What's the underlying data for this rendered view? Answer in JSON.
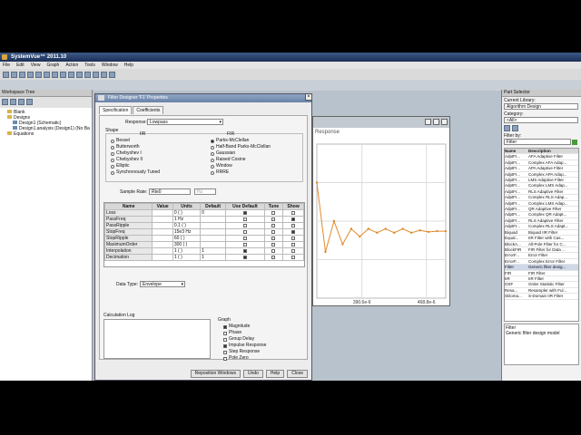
{
  "app": {
    "title": "SystemVue™ 2011.10"
  },
  "menu": [
    "File",
    "Edit",
    "View",
    "Graph",
    "Action",
    "Tools",
    "Window",
    "Help"
  ],
  "workspace": {
    "title": "Workspace Tree",
    "items": [
      {
        "label": "Blank",
        "indent": 1
      },
      {
        "label": "Designs",
        "indent": 1
      },
      {
        "label": "Design1 (Schematic)",
        "indent": 2
      },
      {
        "label": "Design1.analysis (Design1) (No Ba",
        "indent": 2
      },
      {
        "label": "Equations",
        "indent": 1
      }
    ]
  },
  "dialog": {
    "title": "Filter Designer 'F1' Properties",
    "tabs": [
      "Specification",
      "Coefficients"
    ],
    "response_label": "Response:",
    "response_value": "Lowpass",
    "shape_label": "Shape",
    "iir_label": "IIR",
    "fir_label": "FIR",
    "iir_options": [
      {
        "label": "Bessel",
        "on": false
      },
      {
        "label": "Butterworth",
        "on": false
      },
      {
        "label": "Chebyshev I",
        "on": false
      },
      {
        "label": "Chebyshev II",
        "on": false
      },
      {
        "label": "Elliptic",
        "on": false
      },
      {
        "label": "Synchronously Tuned",
        "on": false
      }
    ],
    "fir_options": [
      {
        "label": "Parks-McClellan",
        "on": true
      },
      {
        "label": "Half-Band Parks-McClellan",
        "on": false
      },
      {
        "label": "Gaussian",
        "on": false
      },
      {
        "label": "Raised Cosine",
        "on": false
      },
      {
        "label": "Window",
        "on": false
      },
      {
        "label": "RRRE",
        "on": false
      }
    ],
    "sample_rate_label": "Sample Rate:",
    "sample_rate_value": "Rte0",
    "sample_rate_unit": "Hz",
    "table": {
      "headers": [
        "Name",
        "Value",
        "Units",
        "Default",
        "Use Default",
        "Tune",
        "Show"
      ],
      "rows": [
        {
          "name": "Loss",
          "value": "",
          "units": "0 ( )",
          "default": "0",
          "use": true,
          "tune": false,
          "show": false
        },
        {
          "name": "PassFreq",
          "value": "",
          "units": "1 Hz",
          "default": "",
          "use": false,
          "tune": false,
          "show": true
        },
        {
          "name": "PassRipple",
          "value": "",
          "units": "0.1 ( )",
          "default": "",
          "use": false,
          "tune": false,
          "show": false
        },
        {
          "name": "StopFreq",
          "value": "",
          "units": "15e3 Hz",
          "default": "",
          "use": false,
          "tune": false,
          "show": true
        },
        {
          "name": "StopRipple",
          "value": "",
          "units": "60 ( )",
          "default": "",
          "use": false,
          "tune": false,
          "show": false
        },
        {
          "name": "MaximumOrder",
          "value": "",
          "units": "300 ( )",
          "default": "",
          "use": false,
          "tune": false,
          "show": false
        },
        {
          "name": "Interpolation",
          "value": "",
          "units": "1 ( )",
          "default": "1",
          "use": true,
          "tune": false,
          "show": false
        },
        {
          "name": "Decimation",
          "value": "",
          "units": "1 ( )",
          "default": "1",
          "use": true,
          "tune": false,
          "show": false
        }
      ]
    },
    "data_type_label": "Data Type:",
    "data_type_value": "Envelope",
    "calc_log_label": "Calculation Log",
    "graph_label": "Graph",
    "graph_options": [
      {
        "label": "Magnitude",
        "on": true
      },
      {
        "label": "Phase",
        "on": false
      },
      {
        "label": "Group Delay",
        "on": false
      },
      {
        "label": "Impulse Response",
        "on": true
      },
      {
        "label": "Step Response",
        "on": false
      },
      {
        "label": "Pole Zero",
        "on": false
      }
    ],
    "buttons": [
      "Reposition Windows",
      "Undo",
      "Help",
      "Close"
    ]
  },
  "graph_window": {
    "title": "Response",
    "x_ticks": [
      "390.6e-6",
      "468.8e-6"
    ]
  },
  "chart_data": {
    "type": "line",
    "title": "Response",
    "xlabel": "",
    "ylabel": "",
    "ylim": [
      0.9,
      1.1
    ],
    "x": [
      0,
      1,
      2,
      3,
      4,
      5,
      6,
      7,
      8,
      9,
      10,
      11,
      12,
      13,
      14,
      15
    ],
    "series": [
      {
        "values": [
          1.05,
          0.96,
          1.0,
          0.97,
          0.99,
          0.98,
          0.99,
          0.985,
          0.99,
          0.985,
          0.99,
          0.985,
          0.988,
          0.986,
          0.987,
          0.987
        ]
      }
    ],
    "series_color": "#e08a2a"
  },
  "library": {
    "title": "Part Selector",
    "current_label": "Current Library:",
    "current_value": "Algorithm Design",
    "category_label": "Category:",
    "category_value": "<All>",
    "filter_label": "Filter by:",
    "filter_value": "Filter",
    "headers": [
      "Name",
      "Description"
    ],
    "rows": [
      [
        "AdptFI...",
        "AFA Adaptive Filter"
      ],
      [
        "AdptFI...",
        "Complex AFA Adap..."
      ],
      [
        "AdptFI...",
        "APA Adaptive Filter"
      ],
      [
        "AdptFI...",
        "Complex APA Adap..."
      ],
      [
        "AdptFI...",
        "LMS Adaptive Filter"
      ],
      [
        "AdptFI...",
        "Complex LMS Adap..."
      ],
      [
        "AdptFI...",
        "RLS Adaptive Filter"
      ],
      [
        "AdptFI...",
        "Complex RLS Adap..."
      ],
      [
        "AdptFI...",
        "Complex LMS Adap..."
      ],
      [
        "AdptFI...",
        "QR Adaptive Filter"
      ],
      [
        "AdptFI...",
        "Complex QR Adapt..."
      ],
      [
        "AdptFI...",
        "RLS Adaptive Filter"
      ],
      [
        "AdptFI...",
        "Complex RLS Adapt..."
      ],
      [
        "Biquad",
        "Biquad IIR Filter"
      ],
      [
        "Equal...",
        "IIR Filter with Cas..."
      ],
      [
        "BlockA...",
        "All-Pole Filter for C..."
      ],
      [
        "BlockFIR",
        "FIR Filter for Data ..."
      ],
      [
        "ErrorF...",
        "Error Filter"
      ],
      [
        "ErrorF...",
        "Complex Error Filter"
      ],
      [
        "Filter",
        "Generic filter desig..."
      ],
      [
        "FIR",
        "FIR Filter"
      ],
      [
        "IIR",
        "IIR Filter"
      ],
      [
        "OSF",
        "Order Statistic Filter"
      ],
      [
        "Resa...",
        "Resampler with Ful..."
      ],
      [
        "SDoma...",
        "S-Domain IIR Filter"
      ]
    ],
    "selected_index": 19,
    "info_title": "Filter",
    "info_text": "Generic filter design model"
  }
}
